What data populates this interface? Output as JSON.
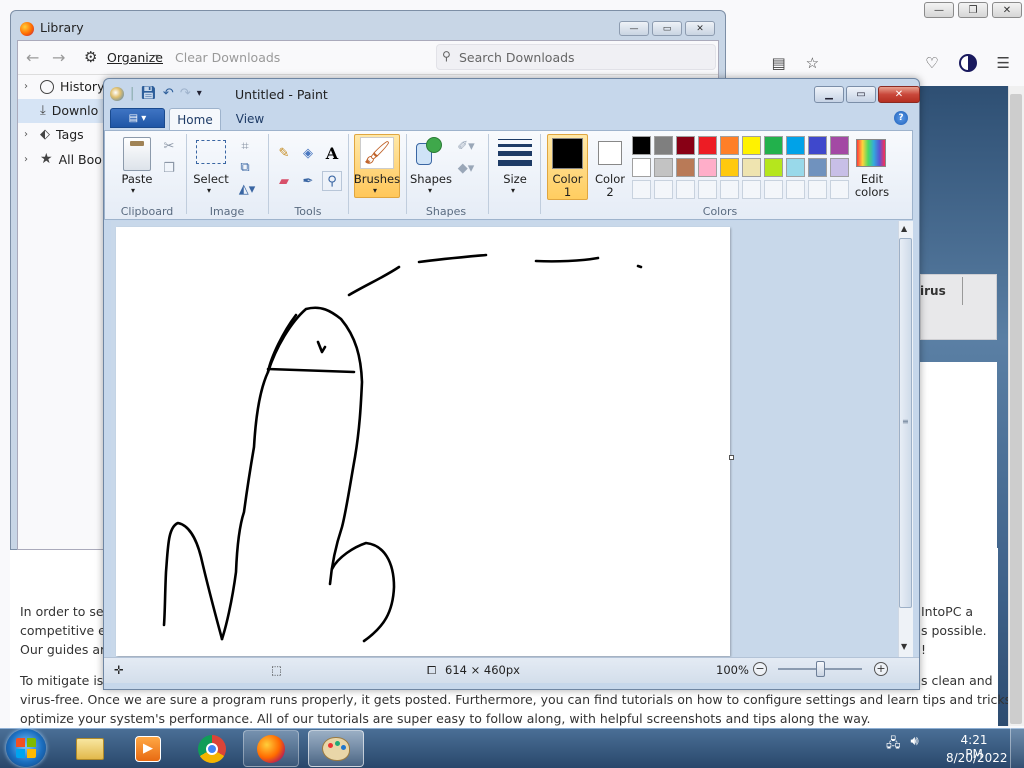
{
  "browser": {
    "page_card_text": "irus",
    "paragraph_lines": [
      "In order to ser",
      "competitive ec",
      "Our guides ar",
      "To mitigate iss",
      "virus-free. Once we are sure a program runs properly, it gets posted. Furthermore, you can find tutorials on how to configure settings and learn tips and tricks to",
      "optimize your system's performance. All of our tutorials are super easy to follow along, with helpful screenshots and tips along the way."
    ],
    "right_fragments": [
      "IntoPC a",
      "s possible.",
      "!",
      "s clean and"
    ]
  },
  "library": {
    "title": "Library",
    "organize": "Organize",
    "clear_downloads": "Clear Downloads",
    "search_placeholder": "Search Downloads",
    "sidebar": [
      {
        "label": "History",
        "icon": "clock-icon"
      },
      {
        "label": "Downlo",
        "icon": "download-icon"
      },
      {
        "label": "Tags",
        "icon": "tag-icon"
      },
      {
        "label": "All Boo",
        "icon": "star-icon"
      }
    ]
  },
  "paint": {
    "title": "Untitled - Paint",
    "tabs": [
      "Home",
      "View"
    ],
    "groups": {
      "clipboard": {
        "label": "Clipboard",
        "paste": "Paste"
      },
      "image": {
        "label": "Image",
        "select": "Select"
      },
      "tools": {
        "label": "Tools"
      },
      "brushes": {
        "label": "Brushes"
      },
      "shapes": {
        "label": "Shapes",
        "button": "Shapes"
      },
      "size": {
        "label": "Size"
      },
      "colors": {
        "label": "Colors",
        "color1": [
          "Color",
          "1"
        ],
        "color2": [
          "Color",
          "2"
        ],
        "edit": [
          "Edit",
          "colors"
        ],
        "palette_row1": [
          "#000000",
          "#7f7f7f",
          "#880015",
          "#ed1c24",
          "#ff7f27",
          "#fff200",
          "#22b14c",
          "#00a2e8",
          "#3f48cc",
          "#a349a4"
        ],
        "palette_row2": [
          "#ffffff",
          "#c3c3c3",
          "#b97a57",
          "#ffaec9",
          "#ffc90e",
          "#efe4b0",
          "#b5e61d",
          "#99d9ea",
          "#7092be",
          "#c8bfe7"
        ]
      }
    },
    "status": {
      "canvas_size": "614 × 460px",
      "zoom": "100%"
    }
  },
  "taskbar": {
    "time": "4:21 PM",
    "date": "8/20/2022"
  }
}
